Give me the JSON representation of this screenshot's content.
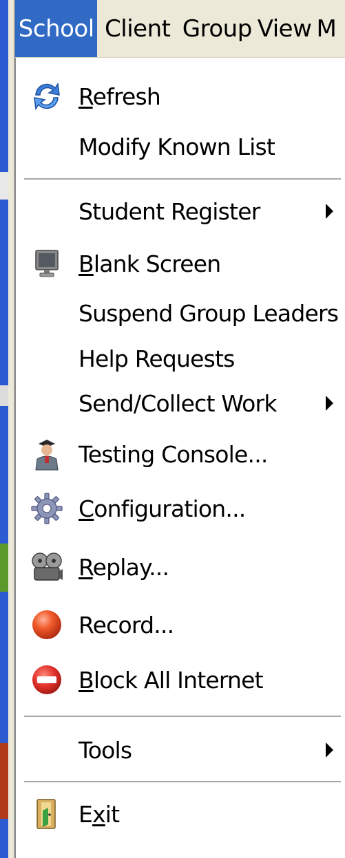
{
  "menubar": {
    "items": [
      {
        "label": "School",
        "active": true
      },
      {
        "label": "Client",
        "active": false
      },
      {
        "label": "Group",
        "active": false
      },
      {
        "label": "View",
        "active": false
      },
      {
        "label": "M",
        "active": false
      }
    ]
  },
  "menu": {
    "items": [
      {
        "pre": "",
        "mn": "R",
        "post": "efresh",
        "icon": "refresh-icon",
        "submenu": false
      },
      {
        "pre": "Modify Known List",
        "mn": "",
        "post": "",
        "icon": "",
        "submenu": false
      },
      {
        "pre": "Student Register",
        "mn": "",
        "post": "",
        "icon": "",
        "submenu": true
      },
      {
        "pre": "",
        "mn": "B",
        "post": "lank Screen",
        "icon": "monitor-icon",
        "submenu": false
      },
      {
        "pre": "Suspend Group Leaders",
        "mn": "",
        "post": "",
        "icon": "",
        "submenu": false
      },
      {
        "pre": "Help Requests",
        "mn": "",
        "post": "",
        "icon": "",
        "submenu": false
      },
      {
        "pre": "Send/Collect Work",
        "mn": "",
        "post": "",
        "icon": "",
        "submenu": true
      },
      {
        "pre": "Testing Console...",
        "mn": "",
        "post": "",
        "icon": "teacher-icon",
        "submenu": false
      },
      {
        "pre": "",
        "mn": "C",
        "post": "onfiguration...",
        "icon": "gear-icon",
        "submenu": false
      },
      {
        "pre": "",
        "mn": "R",
        "post": "eplay...",
        "icon": "film-reel-icon",
        "submenu": false
      },
      {
        "pre": "Record...",
        "mn": "",
        "post": "",
        "icon": "record-icon",
        "submenu": false
      },
      {
        "pre": "",
        "mn": "B",
        "post": "lock All Internet",
        "icon": "block-icon",
        "submenu": false
      },
      {
        "pre": "Tools",
        "mn": "",
        "post": "",
        "icon": "",
        "submenu": true
      },
      {
        "pre": "E",
        "mn": "x",
        "post": "it",
        "icon": "exit-door-icon",
        "submenu": false
      }
    ]
  },
  "colors": {
    "highlight": "#316ac5",
    "menubar_bg": "#ece9d8",
    "frame_blue": "#2c5ad0"
  }
}
